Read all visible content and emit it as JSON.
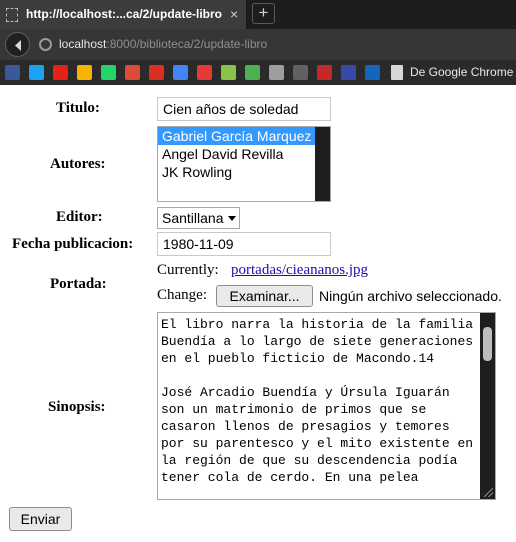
{
  "browser": {
    "tab_title": "http://localhost:...ca/2/update-libro",
    "tab_close": "×",
    "new_tab": "+",
    "url_host": "localhost",
    "url_rest": ":8000/biblioteca/2/update-libro",
    "bookmarks": [
      {
        "icon": "facebook-icon",
        "color": "#3b5998"
      },
      {
        "icon": "twitter-icon",
        "color": "#1da1f2"
      },
      {
        "icon": "youtube-icon",
        "color": "#e62117"
      },
      {
        "icon": "google-drive-icon",
        "color": "#f4b400"
      },
      {
        "icon": "whatsapp-icon",
        "color": "#25d366"
      },
      {
        "icon": "google-plus-icon",
        "color": "#dd4b39"
      },
      {
        "icon": "gmail-icon",
        "color": "#d93025"
      },
      {
        "icon": "google-translate-icon",
        "color": "#4285f4"
      },
      {
        "icon": "bookmark-red-icon",
        "color": "#e53935"
      },
      {
        "icon": "goodreads-icon",
        "color": "#8bc34a"
      },
      {
        "icon": "w3schools-icon",
        "color": "#4caf50"
      },
      {
        "icon": "github-icon",
        "color": "#9e9e9e"
      },
      {
        "icon": "bookmark-gray-icon",
        "color": "#616161"
      },
      {
        "icon": "scribd-icon",
        "color": "#c62828"
      },
      {
        "icon": "edx-icon",
        "color": "#3949ab"
      },
      {
        "icon": "bookmark-blue-icon",
        "color": "#1565c0"
      }
    ],
    "bookmark_label": "De Google Chrome"
  },
  "form": {
    "titulo_label": "Titulo:",
    "titulo_value": "Cien años de soledad",
    "autores_label": "Autores:",
    "autores": [
      {
        "name": "Gabriel García Marquez",
        "selected": true
      },
      {
        "name": "Angel David Revilla",
        "selected": false
      },
      {
        "name": "JK Rowling",
        "selected": false
      }
    ],
    "editor_label": "Editor:",
    "editor_value": "Santillana",
    "fecha_label": "Fecha publicacion:",
    "fecha_value": "1980-11-09",
    "portada_label": "Portada:",
    "currently_label": "Currently:",
    "portada_link": "portadas/cieananos.jpg",
    "change_label": "Change:",
    "browse_button": "Examinar...",
    "no_file": "Ningún archivo seleccionado.",
    "sinopsis_label": "Sinopsis:",
    "sinopsis_text": "El libro narra la historia de la familia Buendía a lo largo de siete generaciones en el pueblo ficticio de Macondo.14\n\nJosé Arcadio Buendía y Úrsula Iguarán son un matrimonio de primos que se casaron llenos de presagios y temores por su parentesco y el mito existente en la región de que su descendencia podía tener cola de cerdo. En una pelea",
    "submit_button": "Enviar"
  }
}
